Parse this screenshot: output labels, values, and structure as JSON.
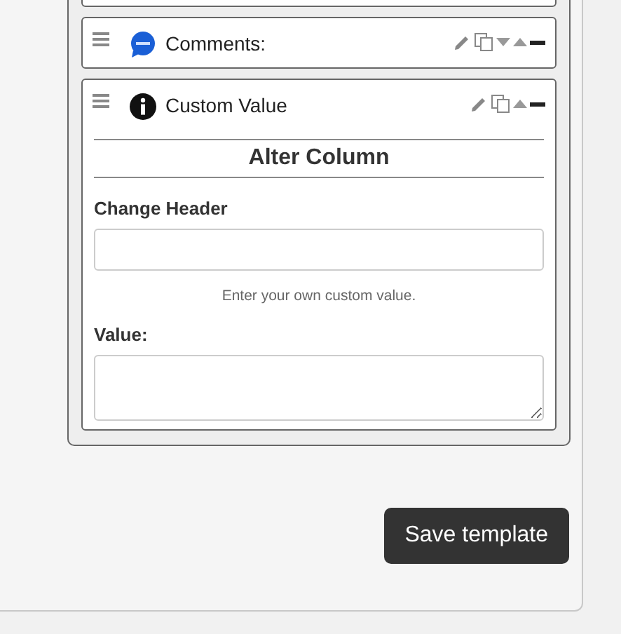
{
  "fields": [
    {
      "kind": "comments",
      "title": "Comments:",
      "actions": [
        {
          "kind": "edit"
        },
        {
          "kind": "copy"
        },
        {
          "kind": "down"
        },
        {
          "kind": "up"
        },
        {
          "kind": "collapse"
        }
      ]
    },
    {
      "kind": "info",
      "title": "Custom Value",
      "actions": [
        {
          "kind": "edit"
        },
        {
          "kind": "copy"
        },
        {
          "kind": "up"
        },
        {
          "kind": "collapse"
        }
      ],
      "form": {
        "heading": "Alter Column",
        "header_label": "Change Header",
        "hint": "Enter your own custom value.",
        "value_label": "Value:"
      }
    }
  ],
  "save_button": "Save template"
}
